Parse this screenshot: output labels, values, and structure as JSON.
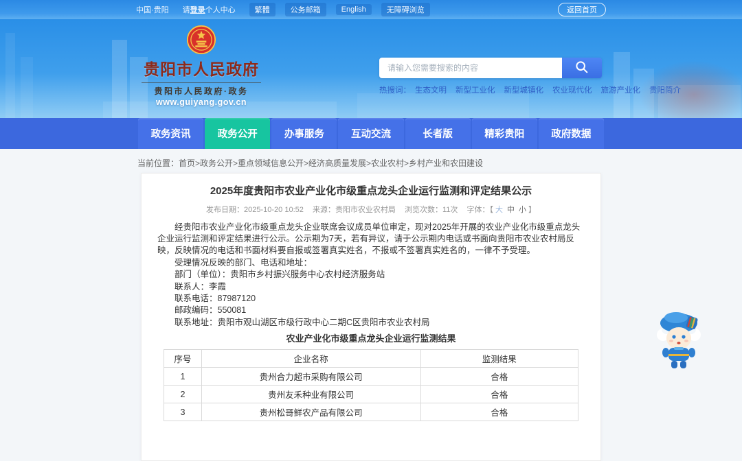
{
  "topbar": {
    "region": "中国·贵阳",
    "login": {
      "prefix": "请",
      "strong": "登录",
      "suffix": "个人中心"
    },
    "links": [
      "繁體",
      "公务邮箱",
      "English",
      "无障碍浏览"
    ],
    "home_button": "返回首页"
  },
  "header": {
    "site_title": "贵阳市人民政府",
    "site_subtitle": "贵阳市人民政府·政务",
    "site_url": "www.guiyang.gov.cn",
    "search": {
      "placeholder": "请输入您需要搜索的内容",
      "hot_label": "热搜词：",
      "hot_words": [
        "生态文明",
        "新型工业化",
        "新型城镇化",
        "农业现代化",
        "旅游产业化",
        "贵阳简介"
      ]
    }
  },
  "nav": {
    "items": [
      {
        "label": "政务资讯",
        "active": false
      },
      {
        "label": "政务公开",
        "active": true
      },
      {
        "label": "办事服务",
        "active": false
      },
      {
        "label": "互动交流",
        "active": false
      },
      {
        "label": "长者版",
        "active": false
      },
      {
        "label": "精彩贵阳",
        "active": false
      },
      {
        "label": "政府数据",
        "active": false
      }
    ]
  },
  "breadcrumb": {
    "label": "当前位置：",
    "path": "首页>政务公开>重点领域信息公开>经济高质量发展>农业农村>乡村产业和农田建设"
  },
  "article": {
    "title": "2025年度贵阳市农业产业化市级重点龙头企业运行监测和评定结果公示",
    "meta": {
      "publish_label": "发布日期：",
      "publish_date": "2025-10-20 10:52",
      "source_label": "来源：",
      "source": "贵阳市农业农村局",
      "views_label": "浏览次数：",
      "views": "11次",
      "font_label": "字体：",
      "bracket_open": "【",
      "sizes": [
        "大",
        "中",
        "小"
      ],
      "bracket_close": "】"
    },
    "paragraphs": [
      "经贵阳市农业产业化市级重点龙头企业联席会议成员单位审定，现对2025年开展的农业产业化市级重点龙头企业运行监测和评定结果进行公示。公示期为7天，若有异议，请于公示期内电话或书面向贵阳市农业农村局反映，反映情况的电话和书面材料要自报或签署真实姓名，不报或不签署真实姓名的，一律不予受理。",
      "受理情况反映的部门、电话和地址："
    ],
    "contact_lines": [
      "部门（单位）：贵阳市乡村振兴服务中心农村经济服务站",
      "联系人：李霞",
      "联系电话：87987120",
      "邮政编码：550081",
      "联系地址：贵阳市观山湖区市级行政中心二期C区贵阳市农业农村局"
    ],
    "table_caption": "农业产业化市级重点龙头企业运行监测结果",
    "table": {
      "headers": [
        "序号",
        "企业名称",
        "监测结果"
      ],
      "rows": [
        [
          "1",
          "贵州合力超市采购有限公司",
          "合格"
        ],
        [
          "2",
          "贵州友禾种业有限公司",
          "合格"
        ],
        [
          "3",
          "贵州松哥鲜农产品有限公司",
          "合格"
        ]
      ]
    }
  },
  "icons": {
    "search": "magnifier-icon",
    "emblem": "china-national-emblem",
    "mascot": "guiyang-mascot-figure"
  },
  "colors": {
    "banner_blue": "#2f97e9",
    "nav_blue": "#3c68de",
    "active_green": "#17c5a0",
    "title_maroon": "#8b2a1c",
    "hot_link_blue": "#3060c6",
    "search_btn_blue": "#3a6fe4"
  }
}
